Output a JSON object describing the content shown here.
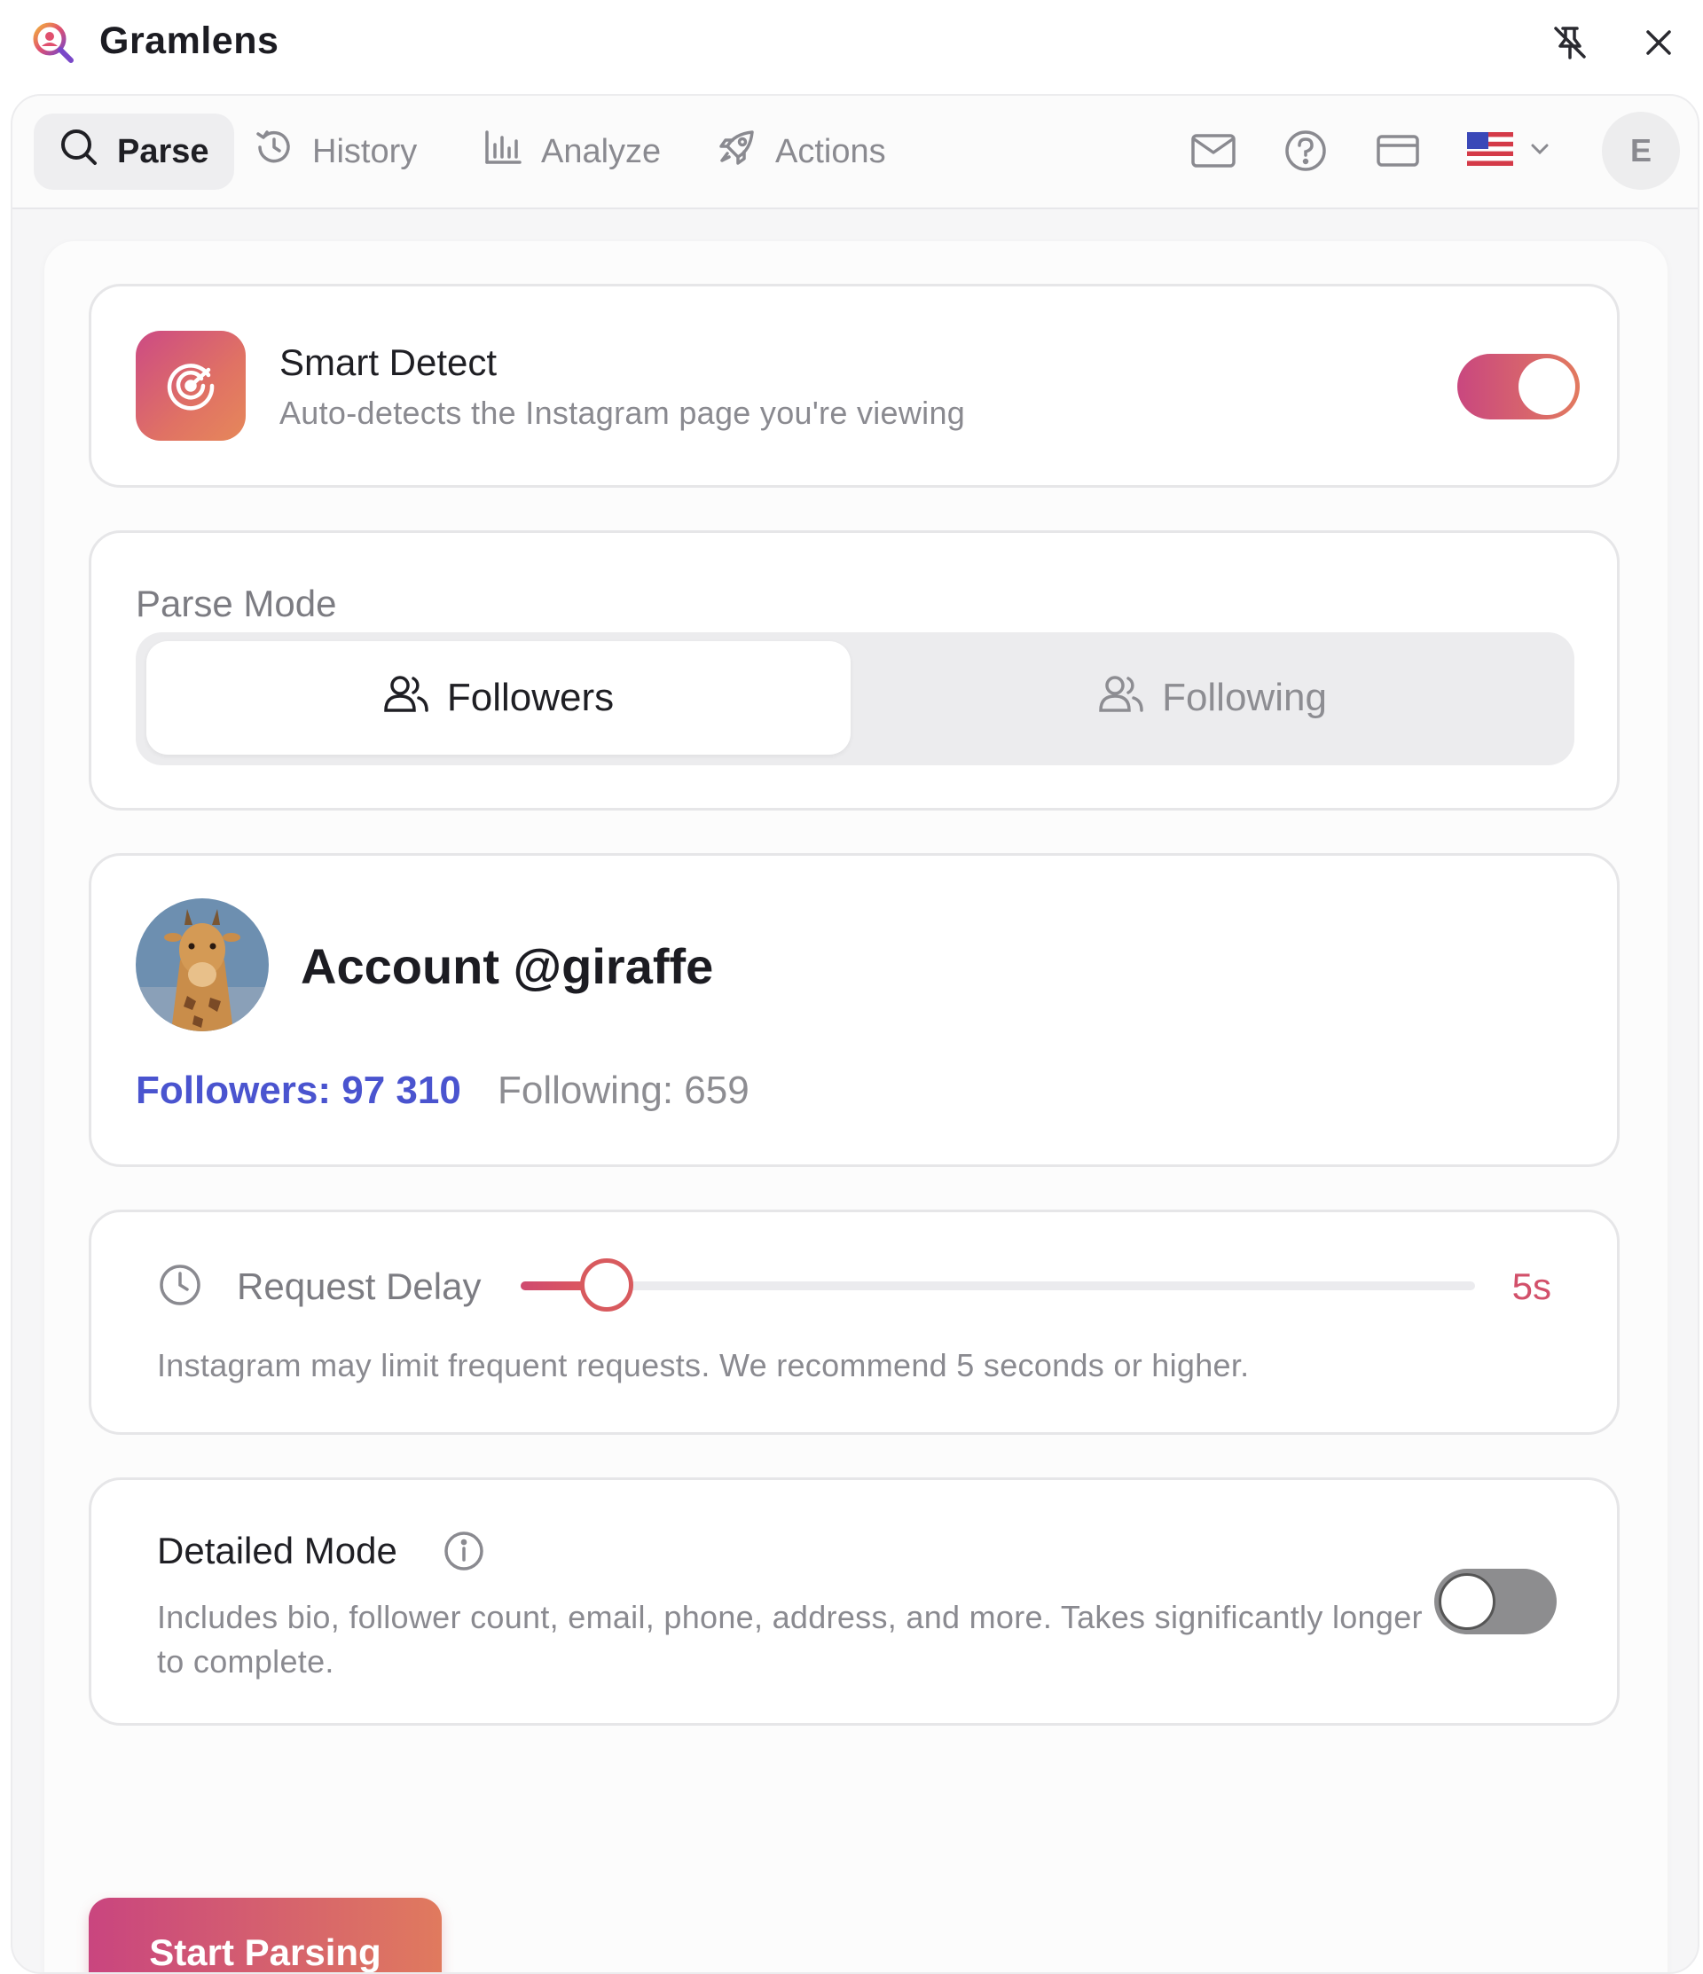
{
  "app": {
    "title": "Gramlens"
  },
  "titlebar": {
    "pin_icon": "unpin-icon",
    "close_icon": "close-icon"
  },
  "nav": {
    "tabs": [
      {
        "label": "Parse",
        "icon": "search-icon",
        "active": true
      },
      {
        "label": "History",
        "icon": "history-icon",
        "active": false
      },
      {
        "label": "Analyze",
        "icon": "bar-chart-icon",
        "active": false
      },
      {
        "label": "Actions",
        "icon": "rocket-icon",
        "active": false
      }
    ],
    "right_icons": [
      "mail-icon",
      "help-icon",
      "card-icon"
    ],
    "language_flag": "us-flag-icon",
    "avatar_letter": "E"
  },
  "smart_detect": {
    "title": "Smart Detect",
    "subtitle": "Auto-detects the Instagram page you're viewing",
    "enabled": true
  },
  "parse_mode": {
    "label": "Parse Mode",
    "options": [
      "Followers",
      "Following"
    ],
    "selected": "Followers"
  },
  "account": {
    "title": "Account @giraffe",
    "followers": "Followers: 97 310",
    "following": "Following: 659"
  },
  "request_delay": {
    "label": "Request Delay",
    "value": "5s",
    "fraction": 0.09,
    "hint": "Instagram may limit frequent requests. We recommend 5 seconds or higher."
  },
  "detailed_mode": {
    "title": "Detailed Mode",
    "description": "Includes bio, follower count, email, phone, address, and more. Takes significantly longer to complete.",
    "enabled": false
  },
  "start_button": {
    "label": "Start Parsing"
  },
  "colors": {
    "accent_pink": "#c9457f",
    "accent_orange": "#e07a5e",
    "link_blue": "#4a54cf"
  }
}
